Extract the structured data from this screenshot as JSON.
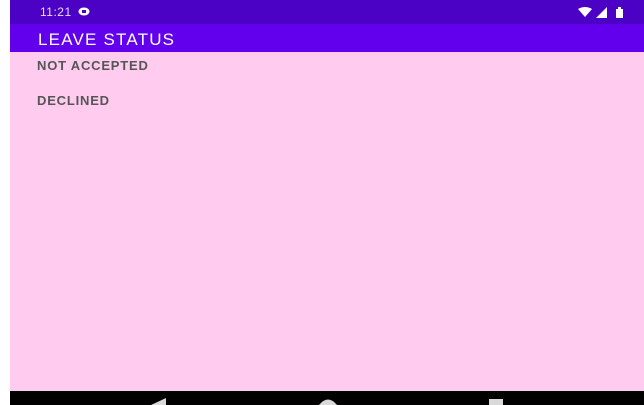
{
  "status_bar": {
    "time": "11:21",
    "icons": [
      "notification-icon",
      "wifi-icon",
      "signal-icon",
      "battery-icon"
    ]
  },
  "app_bar": {
    "title": "LEAVE STATUS"
  },
  "content": {
    "primary_status": "NOT ACCEPTED",
    "secondary_status": "DECLINED"
  },
  "nav_bar": {
    "buttons": [
      "back-icon",
      "home-icon",
      "recents-icon"
    ]
  },
  "colors": {
    "status_bar": "#4b02c4",
    "app_bar": "#6200ee",
    "background": "#ffccf0",
    "text": "#555555",
    "nav_bar": "#000000"
  }
}
